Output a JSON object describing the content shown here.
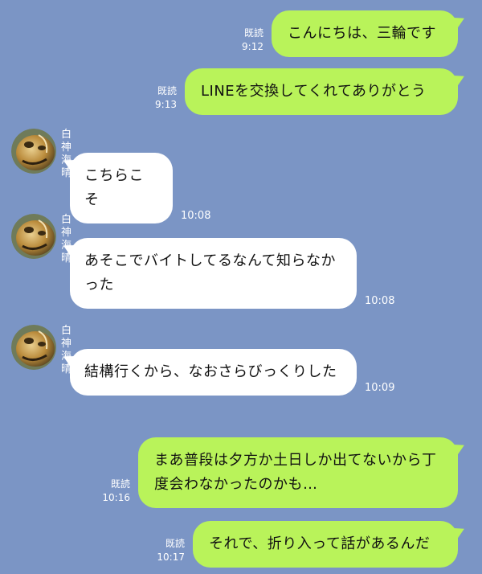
{
  "colors": {
    "background": "#7b95c5",
    "sent_bubble": "#b9f35a",
    "received_bubble": "#ffffff"
  },
  "messages": [
    {
      "direction": "sent",
      "text": "こんにちは、三輪です",
      "read": "既読",
      "time": "9:12"
    },
    {
      "direction": "sent",
      "text": "LINEを交換してくれてありがとう",
      "read": "既読",
      "time": "9:13"
    },
    {
      "direction": "received",
      "sender": "白神海晴",
      "avatar_icon": "golden-mask-avatar",
      "text": "こちらこそ",
      "time": "10:08"
    },
    {
      "direction": "received",
      "sender": "白神海晴",
      "avatar_icon": "golden-mask-avatar",
      "text": "あそこでバイトしてるなんて知らなかった",
      "time": "10:08"
    },
    {
      "direction": "received",
      "sender": "白神海晴",
      "avatar_icon": "golden-mask-avatar",
      "text": "結構行くから、なおさらびっくりした",
      "time": "10:09"
    },
    {
      "direction": "sent",
      "text": "まあ普段は夕方か土日しか出てないから丁度会わなかったのかも…",
      "read": "既読",
      "time": "10:16"
    },
    {
      "direction": "sent",
      "text": "それで、折り入って話があるんだ",
      "read": "既読",
      "time": "10:17"
    }
  ]
}
